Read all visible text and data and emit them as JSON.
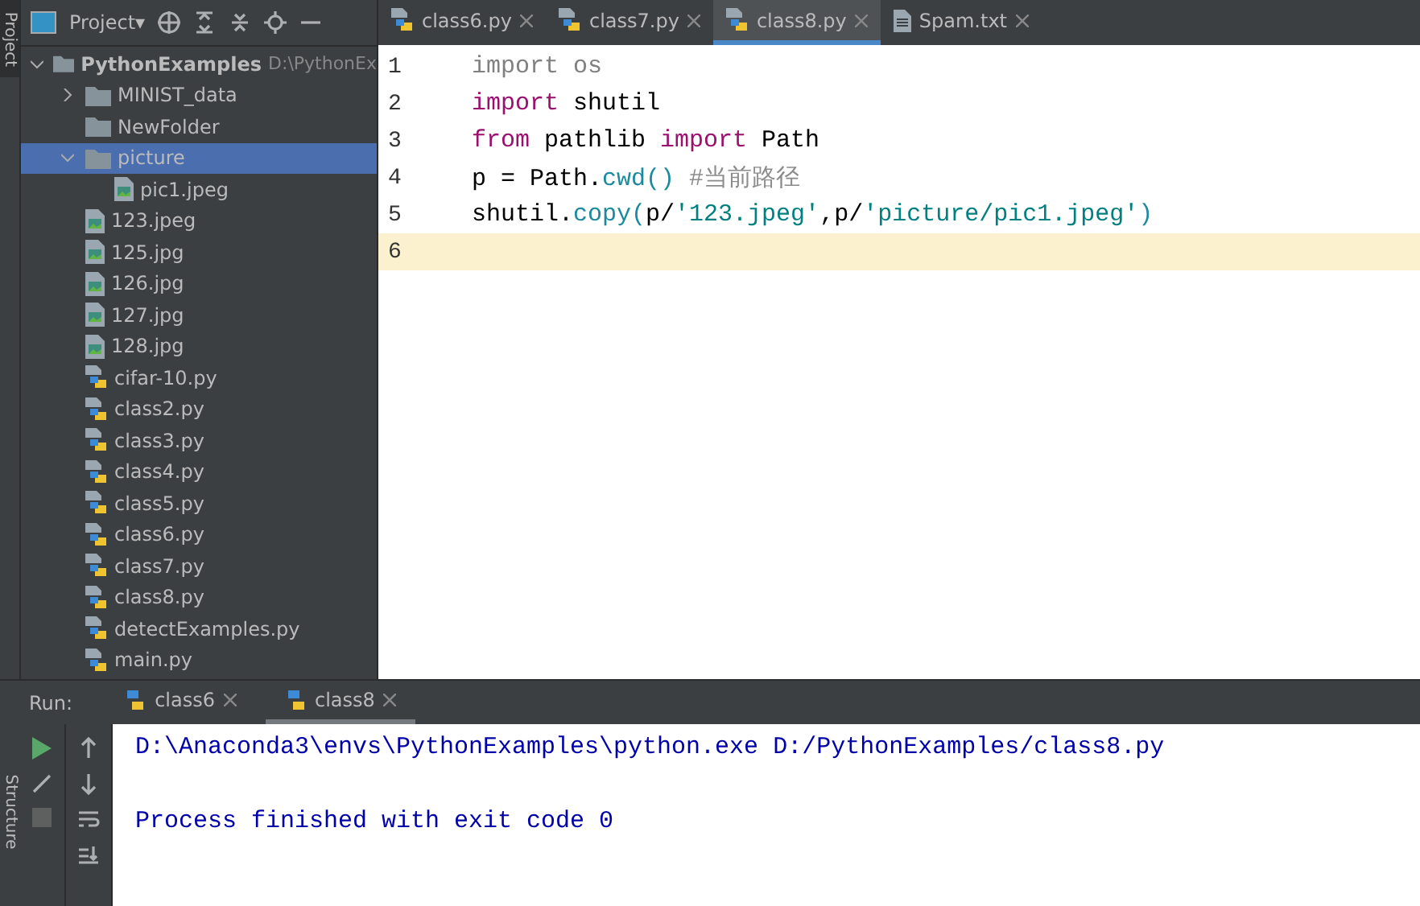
{
  "sidebar_strip": {
    "tab": "Project"
  },
  "project_panel": {
    "title": "Project▾",
    "tree": [
      {
        "label": "PythonExamples",
        "path": "D:\\PythonEx",
        "kind": "folder",
        "expanded": true,
        "selected": false,
        "children": [
          {
            "label": "MINIST_data",
            "kind": "folder",
            "expanded": false,
            "selected": false
          },
          {
            "label": "NewFolder",
            "kind": "folder",
            "selected": false
          },
          {
            "label": "picture",
            "kind": "folder",
            "expanded": true,
            "selected": true,
            "children": [
              {
                "label": "pic1.jpeg",
                "kind": "image",
                "selected": false
              }
            ]
          },
          {
            "label": "123.jpeg",
            "kind": "image",
            "selected": false
          },
          {
            "label": "125.jpg",
            "kind": "image",
            "selected": false
          },
          {
            "label": "126.jpg",
            "kind": "image",
            "selected": false
          },
          {
            "label": "127.jpg",
            "kind": "image",
            "selected": false
          },
          {
            "label": "128.jpg",
            "kind": "image",
            "selected": false
          },
          {
            "label": "cifar-10.py",
            "kind": "python",
            "selected": false
          },
          {
            "label": "class2.py",
            "kind": "python",
            "selected": false
          },
          {
            "label": "class3.py",
            "kind": "python",
            "selected": false
          },
          {
            "label": "class4.py",
            "kind": "python",
            "selected": false
          },
          {
            "label": "class5.py",
            "kind": "python",
            "selected": false
          },
          {
            "label": "class6.py",
            "kind": "python",
            "selected": false
          },
          {
            "label": "class7.py",
            "kind": "python",
            "selected": false
          },
          {
            "label": "class8.py",
            "kind": "python",
            "selected": false
          },
          {
            "label": "detectExamples.py",
            "kind": "python",
            "selected": false
          },
          {
            "label": "main.py",
            "kind": "python",
            "selected": false
          }
        ]
      }
    ]
  },
  "editor": {
    "tabs": [
      {
        "label": "class6.py",
        "kind": "python",
        "selected": false
      },
      {
        "label": "class7.py",
        "kind": "python",
        "selected": false
      },
      {
        "label": "class8.py",
        "kind": "python",
        "selected": true
      },
      {
        "label": "Spam.txt",
        "kind": "text",
        "selected": false
      }
    ],
    "lines": [
      {
        "number": "1",
        "current": false,
        "tokens": [
          {
            "kind": "unused",
            "text": "import os"
          }
        ]
      },
      {
        "number": "2",
        "current": false,
        "tokens": [
          {
            "kind": "keyword",
            "text": "import"
          },
          {
            "kind": "plain",
            "text": " shutil"
          }
        ]
      },
      {
        "number": "3",
        "current": false,
        "tokens": [
          {
            "kind": "keyword",
            "text": "from"
          },
          {
            "kind": "plain",
            "text": " pathlib "
          },
          {
            "kind": "keyword",
            "text": "import"
          },
          {
            "kind": "plain",
            "text": " Path"
          }
        ]
      },
      {
        "number": "4",
        "current": false,
        "tokens": [
          {
            "kind": "plain",
            "text": "p = Path."
          },
          {
            "kind": "func",
            "text": "cwd()"
          },
          {
            "kind": "comment",
            "text": "#当前路径"
          }
        ]
      },
      {
        "number": "5",
        "current": false,
        "tokens": [
          {
            "kind": "plain",
            "text": "shutil."
          },
          {
            "kind": "func",
            "text": "copy("
          },
          {
            "kind": "plain",
            "text": "p/"
          },
          {
            "kind": "string",
            "text": "'123.jpeg'"
          },
          {
            "kind": "plain",
            "text": ",p/"
          },
          {
            "kind": "string",
            "text": "'picture/pic1.jpeg'"
          },
          {
            "kind": "func",
            "text": ")"
          }
        ]
      },
      {
        "number": "6",
        "current": true
      }
    ]
  },
  "run_panel": {
    "label": "Run:",
    "tabs": [
      {
        "label": "class6",
        "selected": false
      },
      {
        "label": "class8",
        "selected": true
      }
    ],
    "side_tab": "Structure",
    "output": [
      "D:\\Anaconda3\\envs\\PythonExamples\\python.exe D:/PythonExamples/class8.py",
      "Process finished with exit code 0"
    ]
  }
}
